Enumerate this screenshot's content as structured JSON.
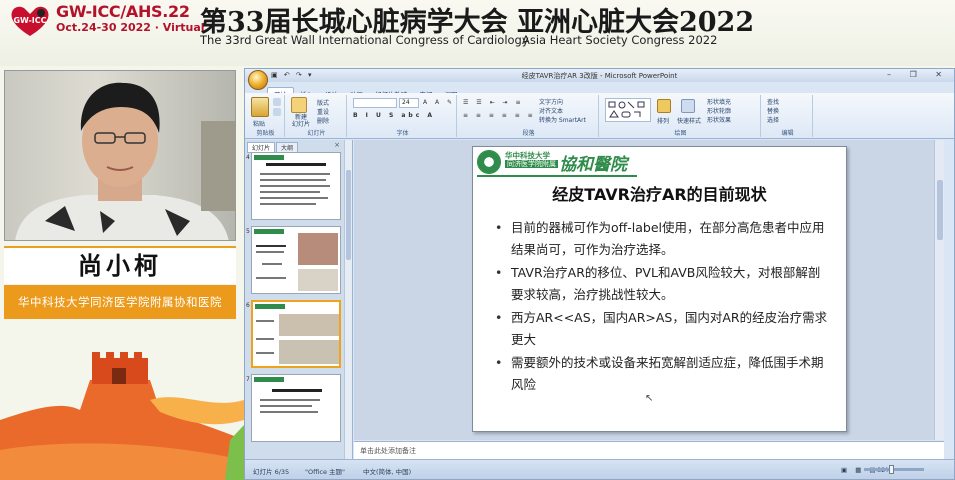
{
  "banner": {
    "conf_name": "GW-ICC/AHS.22",
    "conf_date": "Oct.24-30 2022 · Virtual",
    "logo_text": "GW-ICC",
    "title_cn": "第33届长城心脏病学大会  亚洲心脏大会2022",
    "title_en_1": "The 33rd Great Wall International Congress of Cardiology",
    "title_en_2": "Asia Heart Society Congress 2022"
  },
  "speaker": {
    "name": "尚小柯",
    "affiliation": "华中科技大学同济医学院附属协和医院"
  },
  "ppt": {
    "window_title": "经皮TAVR治疗AR 3改版 - Microsoft PowerPoint",
    "quick_access": "▣ ↶ ↷ ▾",
    "window_controls": "–  ❐  ✕",
    "tabs": [
      "开始",
      "插入",
      "设计",
      "动画",
      "幻灯片放映",
      "审阅",
      "视图"
    ],
    "ribbon_groups": {
      "clipboard": "剪贴板",
      "slides": "幻灯片",
      "font": "字体",
      "paragraph": "段落",
      "drawing": "绘图",
      "editing": "编辑"
    },
    "ribbon_labels": {
      "paste": "粘贴",
      "new_slide": "新建\n幻灯片",
      "layout": "版式",
      "reset": "重设",
      "delete": "删除",
      "font_size": "24",
      "text_direction": "文字方向",
      "align_text": "对齐文本",
      "smartart": "转换为 SmartArt",
      "shapes": "形状",
      "arrange": "排列",
      "quick_styles": "快速样式",
      "shape_fill": "形状填充",
      "shape_outline": "形状轮廓",
      "shape_effect": "形状效果",
      "find": "查找",
      "replace": "替换",
      "select": "选择"
    },
    "panel_tabs": [
      "幻灯片",
      "大纲"
    ],
    "panel_close": "×",
    "thumbnails": [
      {
        "num": "4"
      },
      {
        "num": "5"
      },
      {
        "num": "6"
      },
      {
        "num": "7"
      }
    ],
    "slide": {
      "uni_name": "华中科技大学",
      "uni_name_2": "同济医学院附属",
      "hospital_name": "協和醫院",
      "title": "经皮TAVR治疗AR的目前现状",
      "bullets": [
        "目前的器械可作为off-label使用，在部分高危患者中应用结果尚可，可作为治疗选择。",
        "TAVR治疗AR的移位、PVL和AVB风险较大，对根部解剖要求较高，治疗挑战性较大。",
        "西方AR<<AS，国内AR>AS，国内对AR的经皮治疗需求更大",
        "需要额外的技术或设备来拓宽解剖适应症，降低围手术期风险"
      ]
    },
    "notes_placeholder": "单击此处添加备注",
    "status": {
      "slide_info": "幻灯片 6/35",
      "theme": "\"Office 主题\"",
      "language": "中文(简体, 中国)",
      "zoom": "82%"
    }
  }
}
